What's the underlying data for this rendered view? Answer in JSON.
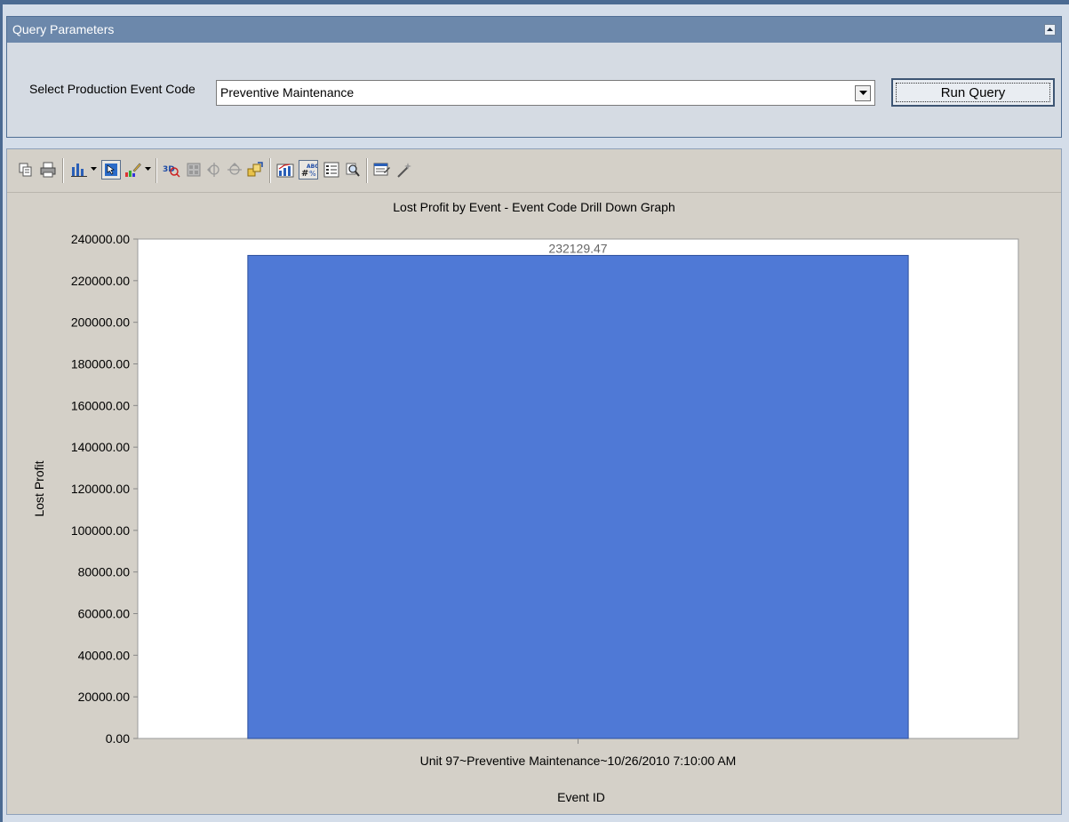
{
  "query_panel": {
    "header_title": "Query Parameters",
    "field_label": "Select Production Event Code",
    "select_value": "Preventive Maintenance",
    "run_button_label": "Run Query"
  },
  "toolbar": {
    "buttons": [
      "copy-icon",
      "print-icon",
      "chart-type-icon",
      "select-mode-icon",
      "palette-icon",
      "3d-rotate-icon",
      "gallery-icon",
      "horizontal-zoom-icon",
      "vertical-zoom-icon",
      "point-labels-icon",
      "data-editor-icon",
      "number-format-icon",
      "legend-icon",
      "zoom-icon",
      "properties-icon",
      "wizard-icon"
    ]
  },
  "chart_data": {
    "type": "bar",
    "title": "Lost Profit by Event - Event Code Drill Down Graph",
    "xlabel": "Event ID",
    "ylabel": "Lost Profit",
    "categories": [
      "Unit 97~Preventive Maintenance~10/26/2010 7:10:00 AM"
    ],
    "values": [
      232129.47
    ],
    "value_labels": [
      "232129.47"
    ],
    "ylim": [
      0,
      240000
    ],
    "y_ticks": [
      "0.00",
      "20000.00",
      "40000.00",
      "60000.00",
      "80000.00",
      "100000.00",
      "120000.00",
      "140000.00",
      "160000.00",
      "180000.00",
      "200000.00",
      "220000.00",
      "240000.00"
    ],
    "bar_color": "#4f79d6",
    "grid": false,
    "legend": false
  }
}
